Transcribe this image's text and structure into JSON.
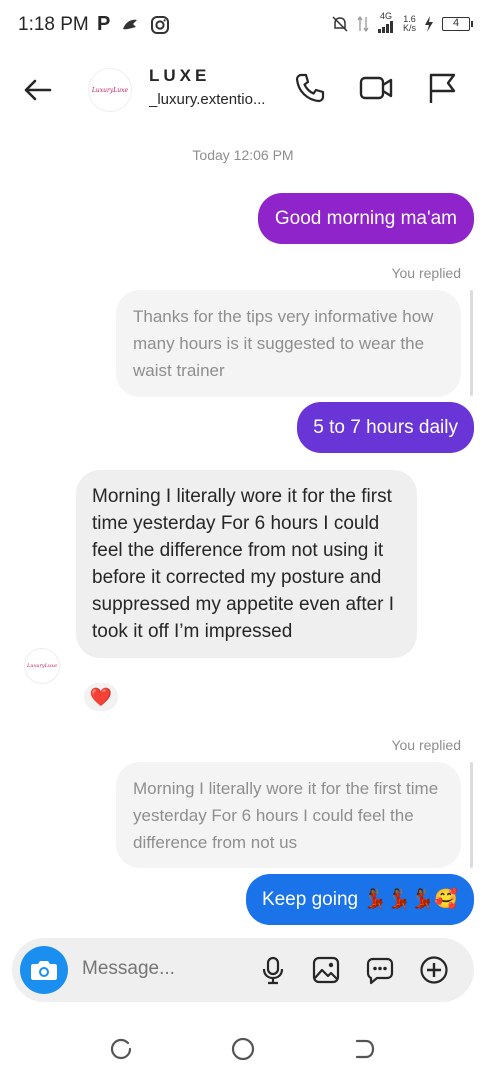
{
  "status_bar": {
    "time": "1:18 PM",
    "network_type": "4G",
    "speed_value": "1.6",
    "speed_unit": "K/s",
    "battery_level": "4",
    "icons": [
      "p-icon",
      "messenger-icon",
      "instagram-icon",
      "mute-icon",
      "data-arrows-icon",
      "signal-icon",
      "charging-icon"
    ]
  },
  "header": {
    "title": "LUXE",
    "subtitle": "_luxury.extentio...",
    "avatar_text": "LuxuryLuxe",
    "icons": [
      "back-arrow-icon",
      "phone-icon",
      "video-camera-icon",
      "flag-icon"
    ]
  },
  "chat": {
    "timestamp": "Today 12:06 PM",
    "messages": [
      {
        "type": "outgoing",
        "text": "Good morning ma'am"
      },
      {
        "type": "reply_label",
        "text": "You replied"
      },
      {
        "type": "quoted",
        "text": "Thanks for the tips very informative how many hours is it suggested to wear the waist trainer"
      },
      {
        "type": "outgoing",
        "text": "5 to 7 hours daily"
      },
      {
        "type": "incoming",
        "text": "Morning I literally wore it for the first time yesterday For 6 hours I could feel the difference from not using it before it corrected my posture and suppressed my appetite even after I took it off I’m impressed",
        "reaction": "❤️"
      },
      {
        "type": "reply_label",
        "text": "You replied"
      },
      {
        "type": "quoted",
        "text": "Morning I literally wore it for the first time yesterday For 6 hours I could feel the difference from not us"
      },
      {
        "type": "outgoing",
        "text": "Keep going 💃🏾💃🏾💃🏾🥰"
      }
    ]
  },
  "composer": {
    "placeholder": "Message...",
    "icons": [
      "camera-icon",
      "microphone-icon",
      "gallery-icon",
      "sticker-icon",
      "add-icon"
    ]
  },
  "nav_bar": {
    "icons": [
      "recents-icon",
      "home-icon",
      "back-nav-icon"
    ]
  },
  "colors": {
    "bubble_purple": "#8e24c9",
    "bubble_violet": "#6a35d6",
    "bubble_blue": "#1a73e8",
    "bubble_incoming": "#efefef",
    "camera_button": "#1a8ff0"
  }
}
